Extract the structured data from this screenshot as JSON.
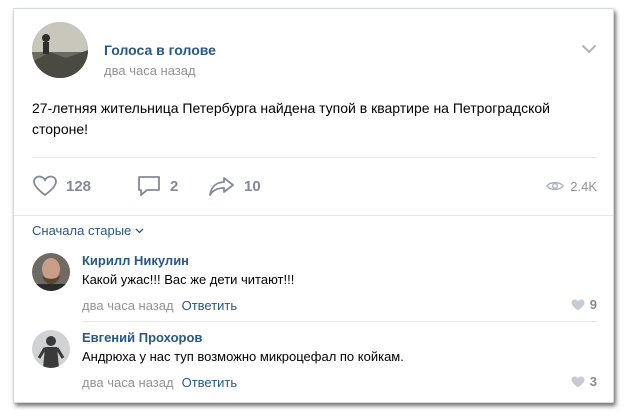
{
  "post": {
    "group_name": "Голоса в голове",
    "time": "два часа назад",
    "text": "27-летняя жительница Петербурга найдена тупой в квартире на Петроградской стороне!",
    "likes": "128",
    "comments": "2",
    "shares": "10",
    "views": "2.4K"
  },
  "comments_section": {
    "sort_label": "Сначала старые",
    "items": [
      {
        "author": "Кирилл Никулин",
        "text": "Какой ужас!!! Вас же дети читают!!!",
        "time": "два часа назад",
        "reply_label": "Ответить",
        "likes": "9"
      },
      {
        "author": "Евгений Прохоров",
        "text": "Андрюха у нас туп возможно микроцефал по койкам.",
        "time": "два часа назад",
        "reply_label": "Ответить",
        "likes": "3"
      }
    ]
  },
  "colors": {
    "link": "#2a5885",
    "muted": "#939393",
    "icon": "#828a99",
    "divider": "#e7e8ec"
  }
}
